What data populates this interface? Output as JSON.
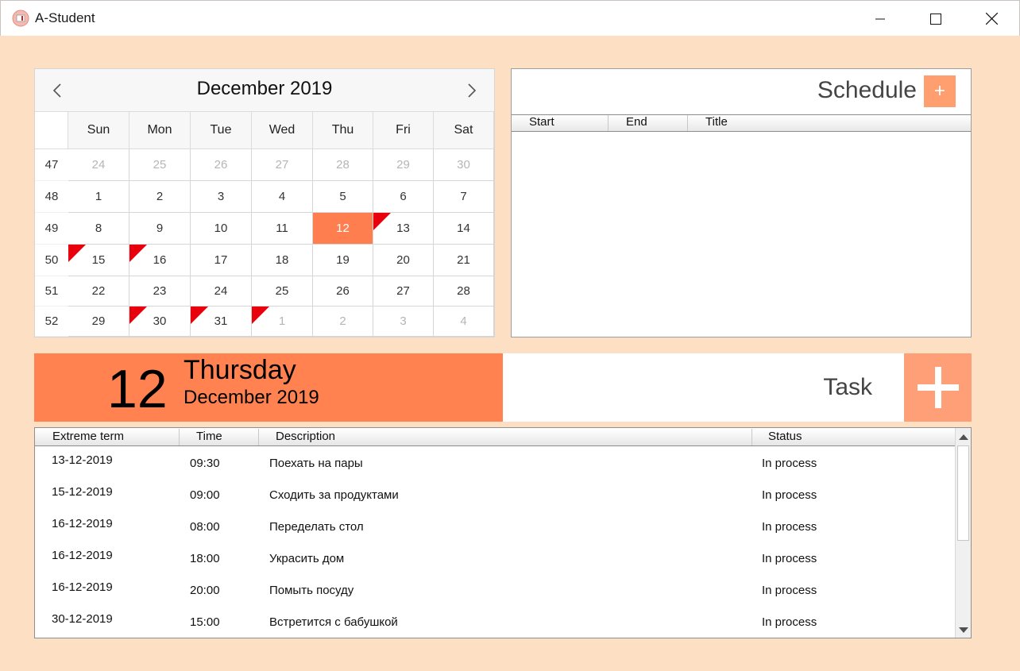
{
  "window": {
    "title": "A-Student"
  },
  "calendar": {
    "month_label": "December 2019",
    "weekdays": [
      "Sun",
      "Mon",
      "Tue",
      "Wed",
      "Thu",
      "Fri",
      "Sat"
    ],
    "weeks": [
      {
        "num": "47",
        "days": [
          {
            "d": "24",
            "other": true
          },
          {
            "d": "25",
            "other": true
          },
          {
            "d": "26",
            "other": true
          },
          {
            "d": "27",
            "other": true
          },
          {
            "d": "28",
            "other": true
          },
          {
            "d": "29",
            "other": true
          },
          {
            "d": "30",
            "other": true
          }
        ]
      },
      {
        "num": "48",
        "days": [
          {
            "d": "1"
          },
          {
            "d": "2"
          },
          {
            "d": "3"
          },
          {
            "d": "4"
          },
          {
            "d": "5"
          },
          {
            "d": "6"
          },
          {
            "d": "7"
          }
        ]
      },
      {
        "num": "49",
        "days": [
          {
            "d": "8"
          },
          {
            "d": "9"
          },
          {
            "d": "10"
          },
          {
            "d": "11"
          },
          {
            "d": "12",
            "selected": true
          },
          {
            "d": "13",
            "flag": true
          },
          {
            "d": "14"
          }
        ]
      },
      {
        "num": "50",
        "days": [
          {
            "d": "15",
            "flag": true
          },
          {
            "d": "16",
            "flag": true
          },
          {
            "d": "17"
          },
          {
            "d": "18"
          },
          {
            "d": "19"
          },
          {
            "d": "20"
          },
          {
            "d": "21"
          }
        ]
      },
      {
        "num": "51",
        "days": [
          {
            "d": "22"
          },
          {
            "d": "23"
          },
          {
            "d": "24"
          },
          {
            "d": "25"
          },
          {
            "d": "26"
          },
          {
            "d": "27"
          },
          {
            "d": "28"
          }
        ]
      },
      {
        "num": "52",
        "days": [
          {
            "d": "29"
          },
          {
            "d": "30",
            "flag": true
          },
          {
            "d": "31",
            "flag": true
          },
          {
            "d": "1",
            "other": true,
            "flag": true
          },
          {
            "d": "2",
            "other": true
          },
          {
            "d": "3",
            "other": true
          },
          {
            "d": "4",
            "other": true
          }
        ]
      }
    ]
  },
  "schedule": {
    "title": "Schedule",
    "add_label": "+",
    "columns": [
      "Start",
      "End",
      "Title"
    ]
  },
  "selected_date": {
    "day": "12",
    "weekday": "Thursday",
    "month_year": "December 2019"
  },
  "task": {
    "title": "Task",
    "columns": [
      "Extreme term",
      "Time",
      "Description",
      "Status"
    ],
    "rows": [
      {
        "term": "13-12-2019",
        "time": "09:30",
        "desc": "Поехать на пары",
        "status": "In process"
      },
      {
        "term": "15-12-2019",
        "time": "09:00",
        "desc": "Сходить за продуктами",
        "status": "In process"
      },
      {
        "term": "16-12-2019",
        "time": "08:00",
        "desc": "Переделать стол",
        "status": "In process"
      },
      {
        "term": "16-12-2019",
        "time": "18:00",
        "desc": "Украсить дом",
        "status": "In process"
      },
      {
        "term": "16-12-2019",
        "time": "20:00",
        "desc": "Помыть посуду",
        "status": "In process"
      },
      {
        "term": "30-12-2019",
        "time": "15:00",
        "desc": "Встретится с бабушкой",
        "status": "In process"
      }
    ]
  },
  "colors": {
    "background": "#fde0c4",
    "accent": "#ff8250",
    "flag": "#e8000c",
    "add_button": "#ff9f70"
  }
}
